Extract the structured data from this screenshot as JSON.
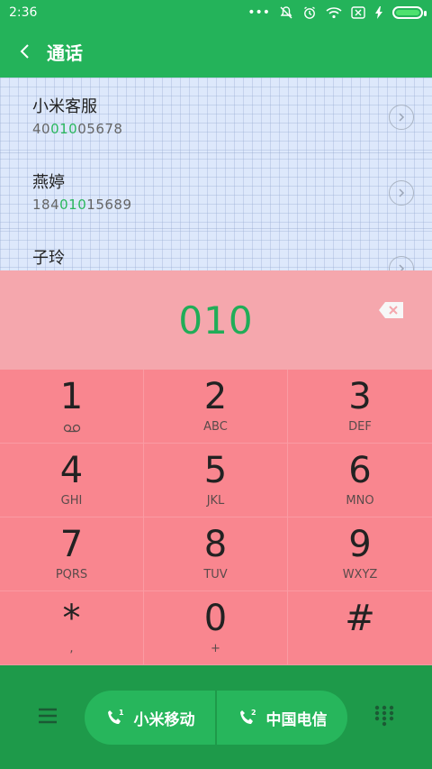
{
  "status": {
    "time": "2:36",
    "dots": "•••"
  },
  "header": {
    "title": "通话"
  },
  "contacts": [
    {
      "name": "小米客服",
      "num_prefix": "40",
      "num_highlight": "010",
      "num_suffix": "05678"
    },
    {
      "name": "燕婷",
      "num_prefix": "184",
      "num_highlight": "010",
      "num_suffix": "15689"
    },
    {
      "name": "子玲",
      "num_prefix": "",
      "num_highlight": "",
      "num_suffix": ""
    }
  ],
  "dialer": {
    "input": "010"
  },
  "keys": [
    {
      "digit": "1",
      "letters": ""
    },
    {
      "digit": "2",
      "letters": "ABC"
    },
    {
      "digit": "3",
      "letters": "DEF"
    },
    {
      "digit": "4",
      "letters": "GHI"
    },
    {
      "digit": "5",
      "letters": "JKL"
    },
    {
      "digit": "6",
      "letters": "MNO"
    },
    {
      "digit": "7",
      "letters": "PQRS"
    },
    {
      "digit": "8",
      "letters": "TUV"
    },
    {
      "digit": "9",
      "letters": "WXYZ"
    },
    {
      "digit": "*",
      "letters": ","
    },
    {
      "digit": "0",
      "letters": "+"
    },
    {
      "digit": "#",
      "letters": ""
    }
  ],
  "sim": [
    {
      "label": "小米移动",
      "slot": "1"
    },
    {
      "label": "中国电信",
      "slot": "2"
    }
  ],
  "colors": {
    "accent": "#24b35a",
    "bottom": "#1e9a4a",
    "keypad": "#f9868f",
    "input_bg": "#f5a7ad",
    "highlight": "#2bb85d"
  },
  "icons": {
    "back": "chevron-left-icon",
    "mute": "bell-off-icon",
    "alarm": "alarm-icon",
    "wifi": "wifi-icon",
    "sim_off": "sim-x-icon",
    "charge": "lightning-icon",
    "battery": "battery-icon",
    "menu": "menu-icon",
    "dialpad": "dialpad-icon",
    "backspace": "backspace-icon",
    "voicemail": "voicemail-icon",
    "phone": "phone-icon"
  }
}
